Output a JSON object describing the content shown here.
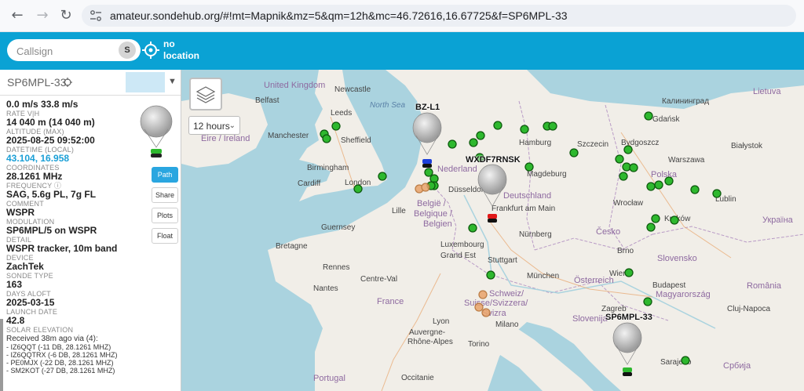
{
  "browser": {
    "url": "amateur.sondehub.org/#!mt=Mapnik&mz=5&qm=12h&mc=46.72616,16.67725&f=SP6MPL-33",
    "back": "←",
    "forward": "→",
    "reload": "↻"
  },
  "header": {
    "search_placeholder": "Callsign",
    "search_button": "S",
    "location_line1": "no",
    "location_line2": "location"
  },
  "sidebar": {
    "selected": "SP6MPL-33",
    "fields": [
      {
        "value": "0.0 m/s 33.8 m/s",
        "label": "RATE V|H"
      },
      {
        "value": "14 040 m (14 040 m)",
        "label": "ALTITUDE (MAX)"
      },
      {
        "value": "2025-08-25 09:52:00",
        "label": "DATETIME (LOCAL)"
      },
      {
        "value": "43.104, 16.958",
        "label": "COORDINATES"
      },
      {
        "value": "28.1261 MHz",
        "label": "FREQUENCY ⓘ"
      },
      {
        "value": "SAG, 5.6g PL, 7g FL",
        "label": "COMMENT"
      },
      {
        "value": "WSPR",
        "label": "MODULATION"
      },
      {
        "value": "SP6MPL/5 on WSPR",
        "label": "DETAIL"
      },
      {
        "value": "WSPR tracker, 10m band",
        "label": "DEVICE"
      },
      {
        "value": "ZachTek",
        "label": "SONDE TYPE"
      },
      {
        "value": "163",
        "label": "DAYS ALOFT"
      },
      {
        "value": "2025-03-15",
        "label": "LAUNCH DATE"
      },
      {
        "value": "42.8",
        "label": "SOLAR ELEVATION"
      }
    ],
    "received_header": "Received 38m ago via (4):",
    "received": [
      "- IZ6QQT (-11 DB, 28.1261 MHZ)",
      "- IZ6QQTRX (-6 DB, 28.1261 MHZ)",
      "- PE0MJX (-22 DB, 28.1261 MHZ)",
      "- SM2KOT (-27 DB, 28.1261 MHZ)"
    ],
    "buttons": {
      "path": "Path",
      "share": "Share",
      "plots": "Plots",
      "float": "Float"
    }
  },
  "map": {
    "hours": "12 hours",
    "balloon_tags": [
      "BZ-L1",
      "WXDF7RNSK",
      "SP6MPL-33"
    ],
    "labels": {
      "united_kingdom": "United Kingdom",
      "eire": "Éire / Ireland",
      "nederland": "Nederland",
      "belgie": "België /",
      "belgique": "Belgique /",
      "belgien": "Belgien",
      "deutschland": "Deutschland",
      "polska": "Polska",
      "cesko": "Česko",
      "slovensko": "Slovensko",
      "osterreich": "Österreich",
      "magyarorszag": "Magyarország",
      "france": "France",
      "schweiz": "Schweiz/",
      "suisse": "Suisse/Svizzera/",
      "svizra": "Svizra",
      "romania": "România",
      "srbija": "Србија",
      "slovenija": "Slovenija",
      "sea_north": "North Sea",
      "manchester": "Manchester",
      "birmingham": "Birmingham",
      "london": "London",
      "leeds": "Leeds",
      "sheffield": "Sheffield",
      "cardiff": "Cardiff",
      "belfast": "Belfast",
      "newcastle": "Newcastle",
      "hamburg": "Hamburg",
      "szczecin": "Szczecin",
      "bydgoszcz": "Bydgoszcz",
      "gdansk": "Gdańsk",
      "warszawa": "Warszawa",
      "bialystok": "Białystok",
      "lublin": "Lublin",
      "wroclaw": "Wrocław",
      "krakow": "Kraków",
      "brno": "Brno",
      "wien": "Wien",
      "budapest": "Budapest",
      "munchen": "München",
      "stuttgart": "Stuttgart",
      "nurnberg": "Nürnberg",
      "frankfurt": "Frankfurt am Main",
      "dusseldorf": "Düsseldorf",
      "magdeburg": "Magdeburg",
      "lille": "Lille",
      "luxembourg": "Luxembourg",
      "rennes": "Rennes",
      "nantes": "Nantes",
      "milano": "Milano",
      "torino": "Torino",
      "lyon": "Lyon",
      "zagreb": "Zagreb",
      "sarajevo": "Sarajevo",
      "cluj": "Cluj-Napoca",
      "lietuva": "Lietuva",
      "guernsey": "Guernsey",
      "kaliningrad": "Калининград",
      "grand_est": "Grand Est",
      "centre": "Centre-Val",
      "auvergne": "Auvergne-",
      "rhone": "Rhône-Alpes",
      "ukraine": "Україна",
      "bretagne": "Bretagne",
      "occitanie": "Occitanie",
      "portugal": "Portugal"
    }
  },
  "colors": {
    "accent": "#0aa2d4",
    "path_button": "#2aa6e0",
    "marker": "#1e8a1e"
  }
}
